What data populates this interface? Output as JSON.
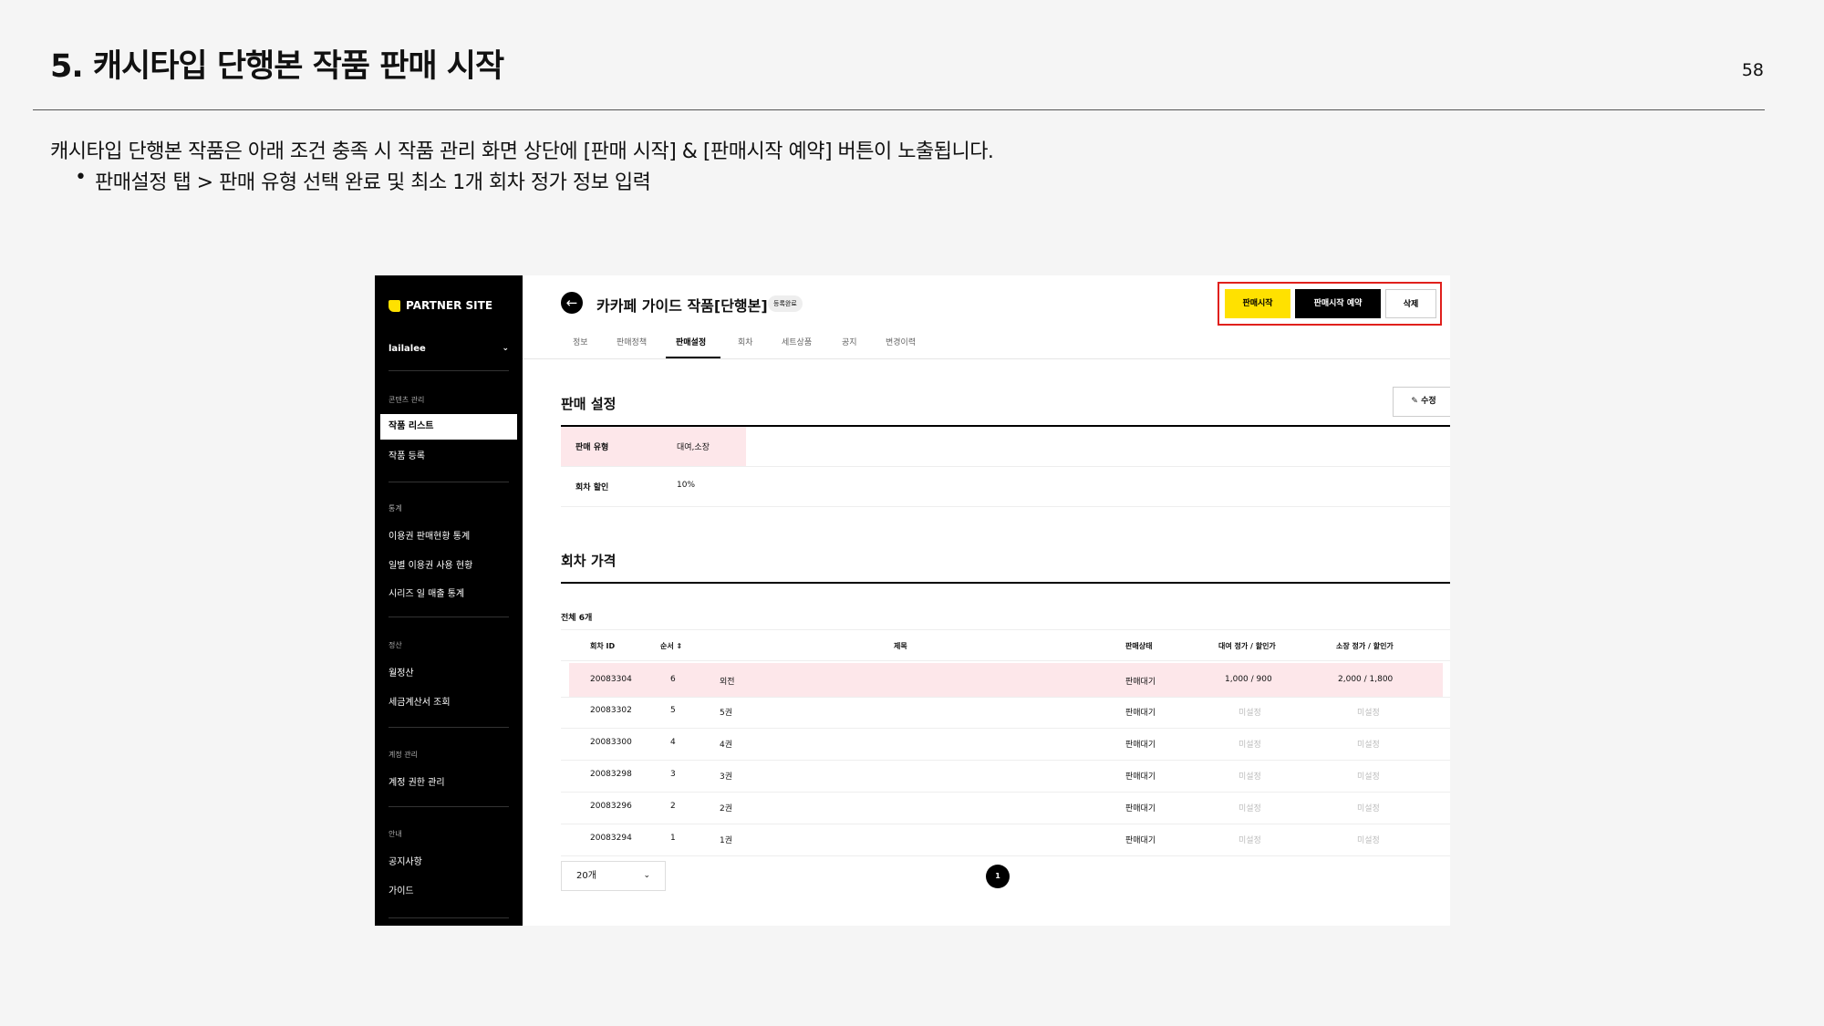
{
  "slide": {
    "title": "5. 캐시타입 단행본 작품 판매 시작",
    "page_number": "58",
    "description": "캐시타입 단행본 작품은 아래 조건 충족 시 작품 관리 화면 상단에 [판매 시작] & [판매시작 예약] 버튼이 노출됩니다.",
    "bullet": "판매설정 탭 > 판매 유형 선택 완료 및 최소 1개 회차 정가 정보 입력"
  },
  "sidebar": {
    "logo": "PARTNER SITE",
    "user": "lailalee",
    "sections": [
      {
        "label": "콘텐츠 관리",
        "items": [
          "작품 리스트",
          "작품 등록"
        ]
      },
      {
        "label": "통계",
        "items": [
          "이용권 판매현황 통계",
          "일별 이용권 사용 현황",
          "시리즈 일 매출 통계"
        ]
      },
      {
        "label": "정산",
        "items": [
          "월정산",
          "세금계산서 조회"
        ]
      },
      {
        "label": "계정 관리",
        "items": [
          "계정 권한 관리"
        ]
      },
      {
        "label": "안내",
        "items": [
          "공지사항",
          "가이드"
        ]
      }
    ]
  },
  "header": {
    "title": "카카페 가이드 작품[단행본]",
    "badge": "등록완료",
    "buttons": {
      "start": "판매시작",
      "reserve": "판매시작 예약",
      "delete": "삭제"
    }
  },
  "tabs": [
    "정보",
    "판매정책",
    "판매설정",
    "회차",
    "세트상품",
    "공지",
    "변경이력"
  ],
  "sales_settings": {
    "title": "판매 설정",
    "edit": "수정",
    "rows": [
      {
        "label": "판매 유형",
        "value": "대여,소장"
      },
      {
        "label": "회차 할인",
        "value": "10%"
      }
    ]
  },
  "episodes": {
    "title": "회차 가격",
    "total": "전체 6개",
    "headers": [
      "회차 ID",
      "순서",
      "제목",
      "판매상태",
      "대여 정가 / 할인가",
      "소장 정가 / 할인가"
    ],
    "rows": [
      {
        "id": "20083304",
        "order": "6",
        "title": "외전",
        "status": "판매대기",
        "rent": "1,000 / 900",
        "own": "2,000 / 1,800"
      },
      {
        "id": "20083302",
        "order": "5",
        "title": "5권",
        "status": "판매대기",
        "rent": "미설정",
        "own": "미설정"
      },
      {
        "id": "20083300",
        "order": "4",
        "title": "4권",
        "status": "판매대기",
        "rent": "미설정",
        "own": "미설정"
      },
      {
        "id": "20083298",
        "order": "3",
        "title": "3권",
        "status": "판매대기",
        "rent": "미설정",
        "own": "미설정"
      },
      {
        "id": "20083296",
        "order": "2",
        "title": "2권",
        "status": "판매대기",
        "rent": "미설정",
        "own": "미설정"
      },
      {
        "id": "20083294",
        "order": "1",
        "title": "1권",
        "status": "판매대기",
        "rent": "미설정",
        "own": "미설정"
      }
    ],
    "page_size": "20개",
    "current_page": "1"
  }
}
